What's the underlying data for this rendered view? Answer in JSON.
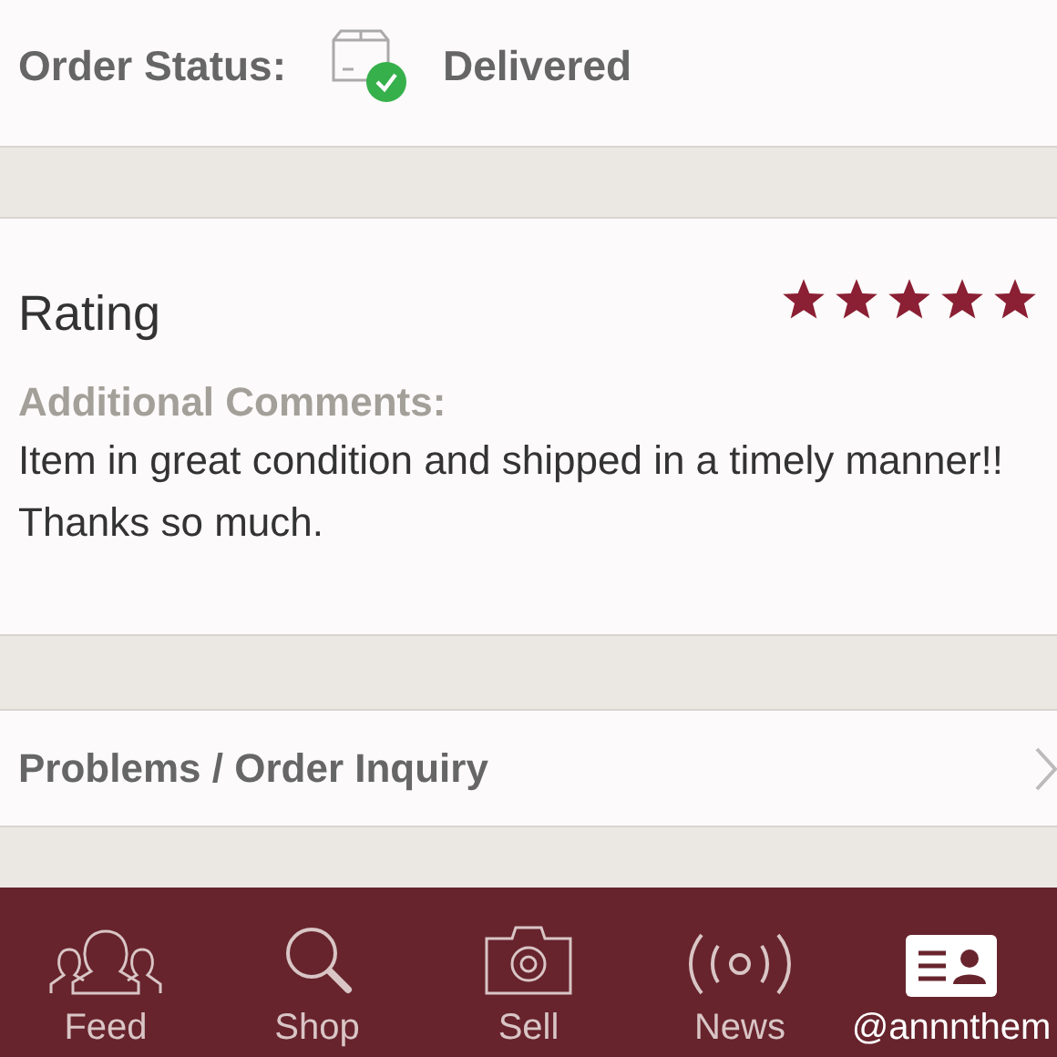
{
  "order_status": {
    "label": "Order Status:",
    "value": "Delivered"
  },
  "rating": {
    "title": "Rating",
    "stars": 5,
    "comments_label": "Additional Comments:",
    "comments": "Item in great condition and shipped in a timely manner!! Thanks so much."
  },
  "inquiry": {
    "label": "Problems / Order Inquiry"
  },
  "tab_bar": [
    {
      "kind": "feed",
      "label": "Feed",
      "selected": false
    },
    {
      "kind": "shop",
      "label": "Shop",
      "selected": false
    },
    {
      "kind": "sell",
      "label": "Sell",
      "selected": false
    },
    {
      "kind": "news",
      "label": "News",
      "selected": false
    },
    {
      "kind": "profile",
      "label": "@annnthem",
      "selected": true
    }
  ]
}
